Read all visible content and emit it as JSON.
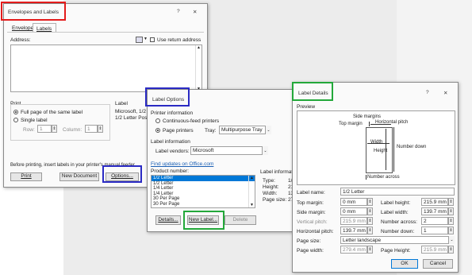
{
  "env": {
    "title": "Envelopes and Labels",
    "help": "?",
    "close": "✕",
    "tabs": [
      "Envelopes",
      "Labels"
    ],
    "address_label": "Address:",
    "use_return_address": "Use return address",
    "print_group": "Print",
    "full_page": "Full page of the same label",
    "single_label": "Single label",
    "row_label": "Row:",
    "row_value": "1",
    "column_label": "Column:",
    "column_value": "1",
    "label_group": "Label",
    "label_line1": "Microsoft, 1/2",
    "label_line2": "1/2 Letter Post",
    "before_printing": "Before printing, insert labels in your printer's manual feeder.",
    "print_btn": "Print",
    "new_doc_btn": "New Document",
    "options_btn": "Options..."
  },
  "opts": {
    "title": "Label Options",
    "printer_info": "Printer information",
    "continuous": "Continuous-feed printers",
    "page_printers": "Page printers",
    "tray_label": "Tray:",
    "tray_value": "Multipurpose Tray",
    "label_info": "Label information",
    "label_vendors": "Label vendors:",
    "vendor_value": "Microsoft",
    "find_updates": "Find updates on Office.com",
    "product_number": "Product number:",
    "products": [
      "1/2 Letter",
      "1/2 Letter",
      "1/4 Letter",
      "1/4 Letter",
      "30 Per Page",
      "30 Per Page"
    ],
    "label_information": "Label information",
    "type_label": "Type:",
    "type_value": "1/2",
    "height_label": "Height:",
    "height_value": "21.",
    "width_label": "Width:",
    "width_value": "13.",
    "page_size_label": "Page size:",
    "page_size_value": "27.",
    "details_btn": "Details...",
    "new_label_btn": "New Label...",
    "delete_btn": "Delete"
  },
  "details": {
    "title": "Label Details",
    "help": "?",
    "close": "✕",
    "preview": "Preview",
    "side_margins": "Side margins",
    "top_margin": "Top margin",
    "horizontal_pitch": "Horizontal pitch",
    "width": "Width",
    "height": "Height",
    "number_down": "Number down",
    "number_across": "Number across",
    "label_name": "Label name:",
    "label_name_value": "1/2 Letter",
    "top_margin_field": "Top margin:",
    "top_margin_value": "0 mm",
    "label_height": "Label height:",
    "label_height_value": "215.9 mm",
    "side_margin": "Side margin:",
    "side_margin_value": "0 mm",
    "label_width": "Label width:",
    "label_width_value": "139.7 mm",
    "vertical_pitch": "Vertical pitch:",
    "vertical_pitch_value": "215.9 mm",
    "number_across_field": "Number across:",
    "number_across_value": "2",
    "horizontal_pitch_field": "Horizontal pitch:",
    "horizontal_pitch_value": "139.7 mm",
    "number_down_field": "Number down:",
    "number_down_value": "1",
    "page_size": "Page size:",
    "page_size_value": "Letter landscape",
    "page_width": "Page width:",
    "page_width_value": "279.4 mm",
    "page_height": "Page Height:",
    "page_height_value": "215.9 mm",
    "ok": "OK",
    "cancel": "Cancel"
  },
  "colors": {
    "red": "#e31b1b",
    "blue": "#2b2bc4",
    "green": "#23a83a",
    "select": "#0078d7"
  }
}
